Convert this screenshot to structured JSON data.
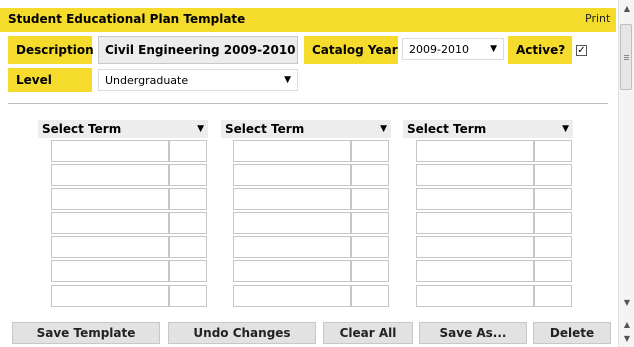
{
  "header": {
    "title": "Student Educational Plan Template",
    "print_label": "Print"
  },
  "form": {
    "description_label": "Description",
    "description_value": "Civil Engineering 2009-2010",
    "catalog_year_label": "Catalog Year",
    "catalog_year_value": "2009-2010",
    "active_label": "Active?",
    "active_checked": true,
    "level_label": "Level",
    "level_value": "Undergraduate"
  },
  "terms": [
    {
      "label": "Select Term"
    },
    {
      "label": "Select Term"
    },
    {
      "label": "Select Term"
    }
  ],
  "buttons": {
    "save_template": "Save Template",
    "undo_changes": "Undo Changes",
    "clear_all": "Clear All",
    "save_as": "Save As...",
    "delete": "Delete"
  },
  "colors": {
    "accent": "#f5dc2c"
  }
}
